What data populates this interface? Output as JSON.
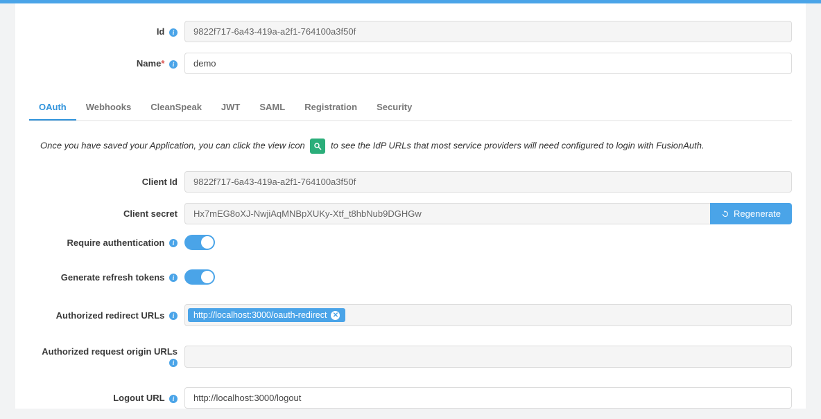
{
  "fields": {
    "id": {
      "label": "Id",
      "value": "9822f717-6a43-419a-a2f1-764100a3f50f"
    },
    "name": {
      "label": "Name",
      "value": "demo"
    }
  },
  "tabs": [
    {
      "label": "OAuth",
      "active": true
    },
    {
      "label": "Webhooks",
      "active": false
    },
    {
      "label": "CleanSpeak",
      "active": false
    },
    {
      "label": "JWT",
      "active": false
    },
    {
      "label": "SAML",
      "active": false
    },
    {
      "label": "Registration",
      "active": false
    },
    {
      "label": "Security",
      "active": false
    }
  ],
  "hint": {
    "pre": "Once you have saved your Application, you can click the view icon",
    "post": "to see the IdP URLs that most service providers will need configured to login with FusionAuth."
  },
  "oauth": {
    "client_id": {
      "label": "Client Id",
      "value": "9822f717-6a43-419a-a2f1-764100a3f50f"
    },
    "client_secret": {
      "label": "Client secret",
      "value": "Hx7mEG8oXJ-NwjiAqMNBpXUKy-Xtf_t8hbNub9DGHGw",
      "regen": "Regenerate"
    },
    "require_auth": {
      "label": "Require authentication",
      "on": true
    },
    "gen_refresh": {
      "label": "Generate refresh tokens",
      "on": true
    },
    "redirect_urls": {
      "label": "Authorized redirect URLs",
      "tags": [
        "http://localhost:3000/oauth-redirect"
      ]
    },
    "origin_urls": {
      "label": "Authorized request origin URLs",
      "tags": []
    },
    "logout_url": {
      "label": "Logout URL",
      "value": "http://localhost:3000/logout"
    }
  }
}
